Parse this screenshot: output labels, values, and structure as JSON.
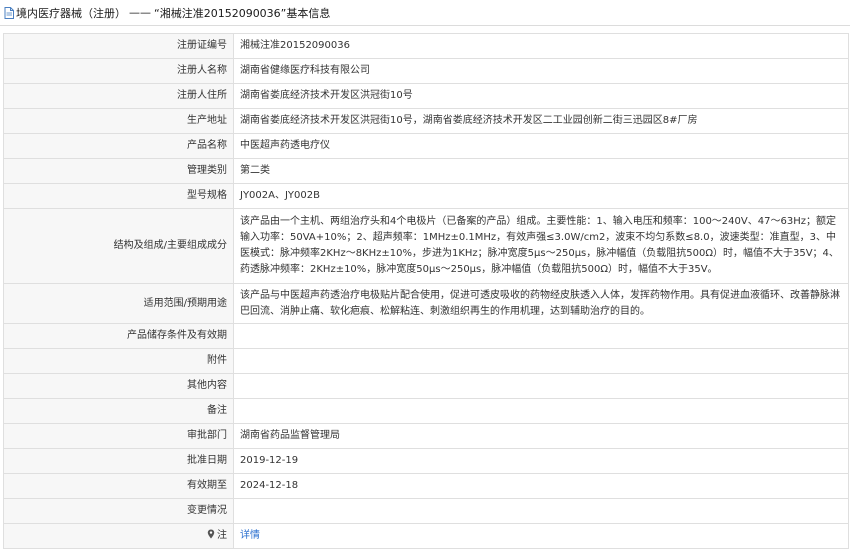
{
  "header": {
    "category": "境内医疗器械（注册）",
    "separator": "——",
    "subject": "“湘械注准20152090036”",
    "suffix": "基本信息"
  },
  "rows": [
    {
      "label": "注册证编号",
      "value": "湘械注准20152090036"
    },
    {
      "label": "注册人名称",
      "value": "湖南省健缘医疗科技有限公司"
    },
    {
      "label": "注册人住所",
      "value": "湖南省娄底经济技术开发区洪冠街10号"
    },
    {
      "label": "生产地址",
      "value": "湖南省娄底经济技术开发区洪冠街10号，湖南省娄底经济技术开发区二工业园创新二街三迅园区8#厂房"
    },
    {
      "label": "产品名称",
      "value": "中医超声药透电疗仪"
    },
    {
      "label": "管理类别",
      "value": "第二类"
    },
    {
      "label": "型号规格",
      "value": "JY002A、JY002B"
    },
    {
      "label": "结构及组成/主要组成成分",
      "value": "该产品由一个主机、两组治疗头和4个电极片（已备案的产品）组成。主要性能：1、输入电压和频率：100～240V、47～63Hz；额定输入功率：50VA+10%；2、超声频率：1MHz±0.1MHz，有效声强≤3.0W/cm2，波束不均匀系数≤8.0，波速类型：准直型，3、中医模式：脉冲频率2KHz～8KHz±10%，步进为1KHz；脉冲宽度5μs～250μs，脉冲幅值（负载阻抗500Ω）时，幅值不大于35V；4、药透脉冲频率：2KHz±10%，脉冲宽度50μs～250μs，脉冲幅值（负载阻抗500Ω）时，幅值不大于35V。"
    },
    {
      "label": "适用范围/预期用途",
      "value": "该产品与中医超声药透治疗电极贴片配合使用，促进可透皮吸收的药物经皮肤透入人体，发挥药物作用。具有促进血液循环、改善静脉淋巴回流、消肿止痛、软化疤痕、松解粘连、刺激组织再生的作用机理，达到辅助治疗的目的。"
    },
    {
      "label": "产品储存条件及有效期",
      "value": ""
    },
    {
      "label": "附件",
      "value": ""
    },
    {
      "label": "其他内容",
      "value": ""
    },
    {
      "label": "备注",
      "value": ""
    },
    {
      "label": "审批部门",
      "value": "湖南省药品监督管理局"
    },
    {
      "label": "批准日期",
      "value": "2019-12-19"
    },
    {
      "label": "有效期至",
      "value": "2024-12-18"
    },
    {
      "label": "变更情况",
      "value": ""
    }
  ],
  "note": {
    "label": "注",
    "link": "详情",
    "icon": "location-pin-icon"
  },
  "icons": {
    "title": "document-icon"
  },
  "colors": {
    "link": "#2a6fcf",
    "label_bg": "#f7f7f7",
    "border": "#dfdfdf"
  }
}
